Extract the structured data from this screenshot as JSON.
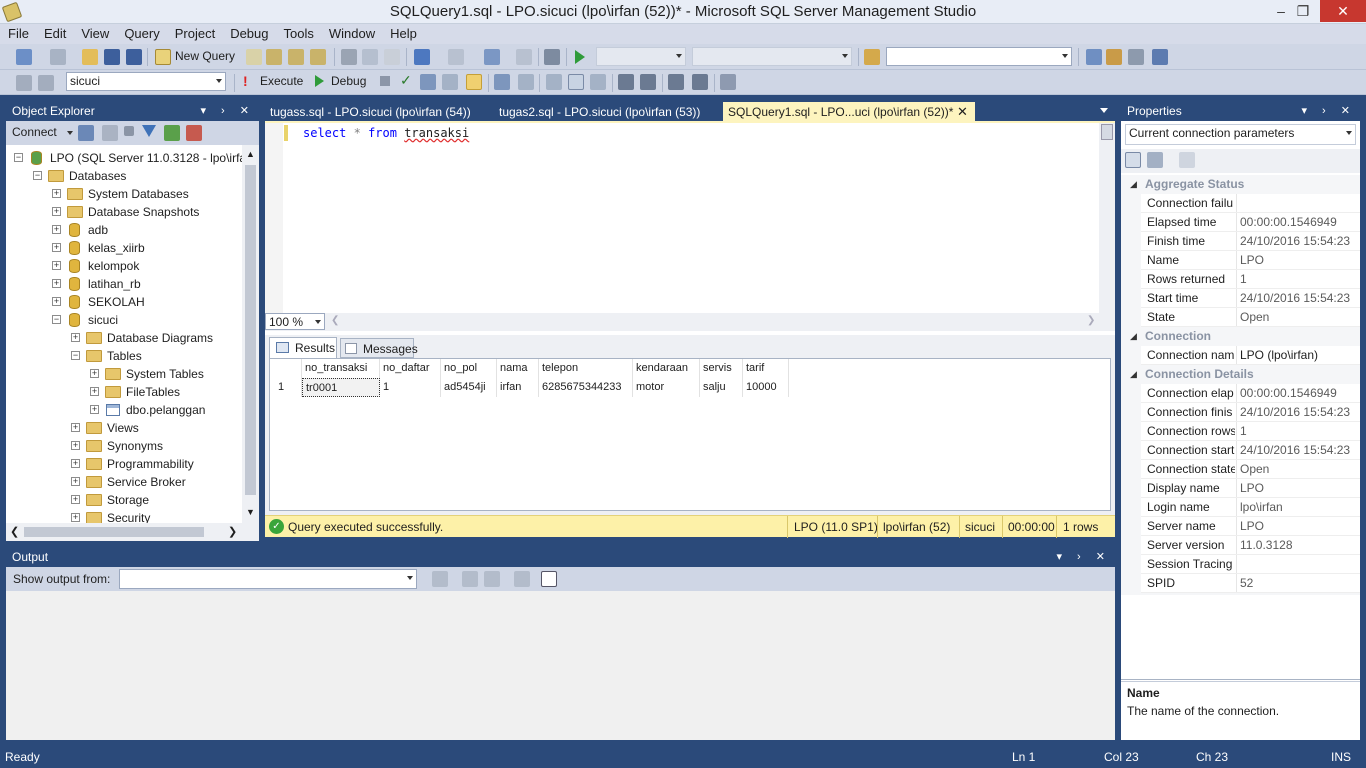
{
  "window": {
    "title": "SQLQuery1.sql - LPO.sicuci (lpo\\irfan (52))* - Microsoft SQL Server Management Studio",
    "minimize": "–",
    "restore": "❐",
    "close": "✕"
  },
  "menu": [
    "File",
    "Edit",
    "View",
    "Query",
    "Project",
    "Debug",
    "Tools",
    "Window",
    "Help"
  ],
  "toolbar1": {
    "new_query": "New Query"
  },
  "toolbar2": {
    "database": "sicuci",
    "execute": "Execute",
    "debug": "Debug"
  },
  "object_explorer": {
    "title": "Object Explorer",
    "connect": "Connect",
    "tree": [
      {
        "label": "LPO (SQL Server 11.0.3128 - lpo\\irfan)",
        "level": 0,
        "icon": "server",
        "exp": "-"
      },
      {
        "label": "Databases",
        "level": 1,
        "icon": "folder",
        "exp": "-"
      },
      {
        "label": "System Databases",
        "level": 2,
        "icon": "folder",
        "exp": "+"
      },
      {
        "label": "Database Snapshots",
        "level": 2,
        "icon": "folder",
        "exp": "+"
      },
      {
        "label": "adb",
        "level": 2,
        "icon": "db",
        "exp": "+"
      },
      {
        "label": "kelas_xiirb",
        "level": 2,
        "icon": "db",
        "exp": "+"
      },
      {
        "label": "kelompok",
        "level": 2,
        "icon": "db",
        "exp": "+"
      },
      {
        "label": "latihan_rb",
        "level": 2,
        "icon": "db",
        "exp": "+"
      },
      {
        "label": "SEKOLAH",
        "level": 2,
        "icon": "db",
        "exp": "+"
      },
      {
        "label": "sicuci",
        "level": 2,
        "icon": "db",
        "exp": "-"
      },
      {
        "label": "Database Diagrams",
        "level": 3,
        "icon": "folder",
        "exp": "+"
      },
      {
        "label": "Tables",
        "level": 3,
        "icon": "folder",
        "exp": "-"
      },
      {
        "label": "System Tables",
        "level": 4,
        "icon": "folder",
        "exp": "+"
      },
      {
        "label": "FileTables",
        "level": 4,
        "icon": "folder",
        "exp": "+"
      },
      {
        "label": "dbo.pelanggan",
        "level": 4,
        "icon": "table",
        "exp": "+"
      },
      {
        "label": "Views",
        "level": 3,
        "icon": "folder",
        "exp": "+"
      },
      {
        "label": "Synonyms",
        "level": 3,
        "icon": "folder",
        "exp": "+"
      },
      {
        "label": "Programmability",
        "level": 3,
        "icon": "folder",
        "exp": "+"
      },
      {
        "label": "Service Broker",
        "level": 3,
        "icon": "folder",
        "exp": "+"
      },
      {
        "label": "Storage",
        "level": 3,
        "icon": "folder",
        "exp": "+"
      },
      {
        "label": "Security",
        "level": 3,
        "icon": "folder",
        "exp": "+"
      }
    ]
  },
  "tabs": [
    {
      "label": "tugass.sql - LPO.sicuci (lpo\\irfan (54))",
      "active": false
    },
    {
      "label": "tugas2.sql - LPO.sicuci (lpo\\irfan (53))",
      "active": false
    },
    {
      "label": "SQLQuery1.sql - LPO...uci (lpo\\irfan (52))*",
      "active": true
    }
  ],
  "editor": {
    "kw1": "select",
    "star": "*",
    "kw2": "from",
    "ident": "transaksi",
    "zoom": "100 %"
  },
  "results": {
    "tab_results": "Results",
    "tab_messages": "Messages",
    "columns": [
      "no_transaksi",
      "no_daftar",
      "no_pol",
      "nama",
      "telepon",
      "kendaraan",
      "servis",
      "tarif"
    ],
    "rows": [
      {
        "n": "1",
        "cells": [
          "tr0001",
          "1",
          "ad5454ji",
          "irfan",
          "6285675344233",
          "motor",
          "salju",
          "10000"
        ]
      }
    ]
  },
  "query_status": {
    "message": "Query executed successfully.",
    "server": "LPO (11.0 SP1)",
    "user": "lpo\\irfan (52)",
    "db": "sicuci",
    "time": "00:00:00",
    "rows": "1 rows"
  },
  "output": {
    "title": "Output",
    "show_from": "Show output from:"
  },
  "properties": {
    "title": "Properties",
    "selector": "Current connection parameters",
    "rows": [
      {
        "type": "cat",
        "k": "Aggregate Status"
      },
      {
        "k": "Connection failu",
        "v": ""
      },
      {
        "k": "Elapsed time",
        "v": "00:00:00.1546949"
      },
      {
        "k": "Finish time",
        "v": "24/10/2016 15:54:23"
      },
      {
        "k": "Name",
        "v": "LPO"
      },
      {
        "k": "Rows returned",
        "v": "1"
      },
      {
        "k": "Start time",
        "v": "24/10/2016 15:54:23"
      },
      {
        "k": "State",
        "v": "Open"
      },
      {
        "type": "cat",
        "k": "Connection"
      },
      {
        "k": "Connection nam",
        "v": "LPO (lpo\\irfan)",
        "dark": true
      },
      {
        "type": "cat",
        "k": "Connection Details"
      },
      {
        "k": "Connection elap",
        "v": "00:00:00.1546949"
      },
      {
        "k": "Connection finis",
        "v": "24/10/2016 15:54:23"
      },
      {
        "k": "Connection rows",
        "v": "1"
      },
      {
        "k": "Connection start",
        "v": "24/10/2016 15:54:23"
      },
      {
        "k": "Connection state",
        "v": "Open"
      },
      {
        "k": "Display name",
        "v": "LPO"
      },
      {
        "k": "Login name",
        "v": "lpo\\irfan"
      },
      {
        "k": "Server name",
        "v": "LPO"
      },
      {
        "k": "Server version",
        "v": "11.0.3128"
      },
      {
        "k": "Session Tracing I",
        "v": ""
      },
      {
        "k": "SPID",
        "v": "52"
      }
    ],
    "desc_title": "Name",
    "desc_text": "The name of the connection."
  },
  "status": {
    "ready": "Ready",
    "ln": "Ln 1",
    "col": "Col 23",
    "ch": "Ch 23",
    "ins": "INS"
  },
  "colors": {
    "chrome": "#2b4a7a",
    "active_tab": "#fdf4bf",
    "status_yellow": "#fdf1a8"
  }
}
